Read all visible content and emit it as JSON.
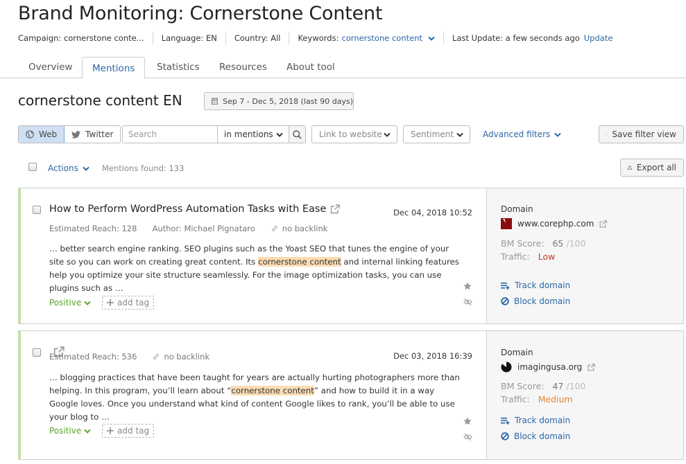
{
  "header": {
    "title": "Brand Monitoring: Cornerstone Content",
    "meta": {
      "campaign": "Campaign: cornerstone conte...",
      "language": "Language: EN",
      "country": "Country: All",
      "keywords_label": "Keywords:",
      "keywords_value": "cornerstone content",
      "last_update": "Last Update: a few seconds ago",
      "update_link": "Update"
    }
  },
  "tabs": [
    {
      "label": "Overview",
      "active": false
    },
    {
      "label": "Mentions",
      "active": true
    },
    {
      "label": "Statistics",
      "active": false
    },
    {
      "label": "Resources",
      "active": false
    },
    {
      "label": "About tool",
      "active": false
    }
  ],
  "section": {
    "title": "cornerstone content EN",
    "date_range": "Sep 7 - Dec 5, 2018 (last 90 days)"
  },
  "filters": {
    "source_web": "Web",
    "source_twitter": "Twitter",
    "search_placeholder": "Search",
    "search_scope": "in mentions",
    "link_to_website": "Link to website",
    "sentiment": "Sentiment",
    "advanced_filters": "Advanced filters",
    "save_filter_view": "Save filter view"
  },
  "list_toolbar": {
    "actions": "Actions",
    "mentions_found": "Mentions found: 133",
    "export_all": "Export all"
  },
  "colors": {
    "accent": "#2b66a8",
    "positive": "#5aa52a",
    "traffic_low": "#c0392b",
    "traffic_medium": "#e8832f",
    "highlight": "#fbdcb4",
    "card_stripe": "#c3e0a8"
  },
  "mentions": [
    {
      "title": "How to Perform WordPress Automation Tasks with Ease",
      "date": "Dec 04, 2018 10:52",
      "reach": "Estimated Reach: 128",
      "author": "Author: Michael Pignataro",
      "backlink": "no backlink",
      "snippet_before": "… better search engine ranking. SEO plugins such as the Yoast SEO that tunes the engine of your site so you can work on creating great content. Its ",
      "snippet_highlight": "cornerstone content",
      "snippet_after": " and internal linking features help you optimize your site structure seamlessly. For the image optimization tasks, you can use plugins such as …",
      "sentiment": "Positive",
      "add_tag": "add tag",
      "domain_label": "Domain",
      "domain": "www.corephp.com",
      "favicon": "red-square",
      "bm_score_label": "BM Score:",
      "bm_score": "65",
      "bm_score_max": "/100",
      "traffic_label": "Traffic:",
      "traffic": "Low",
      "track_domain": "Track domain",
      "block_domain": "Block domain"
    },
    {
      "title": "",
      "date": "Dec 03, 2018 16:39",
      "reach": "Estimated Reach: 536",
      "author": "",
      "backlink": "no backlink",
      "snippet_before": "… blogging practices that have been taught for years are actually hurting photographers more than helping. In this program, you’ll learn about “",
      "snippet_highlight": "cornerstone content",
      "snippet_after": "” and how to build it in a way Google loves. Once you understand what kind of content Google likes to rank, you’ll be able to use your blog to …",
      "sentiment": "Positive",
      "add_tag": "add tag",
      "domain_label": "Domain",
      "domain": "imagingusa.org",
      "favicon": "black-circle",
      "bm_score_label": "BM Score:",
      "bm_score": "47",
      "bm_score_max": "/100",
      "traffic_label": "Traffic:",
      "traffic": "Medium",
      "track_domain": "Track domain",
      "block_domain": "Block domain"
    }
  ]
}
